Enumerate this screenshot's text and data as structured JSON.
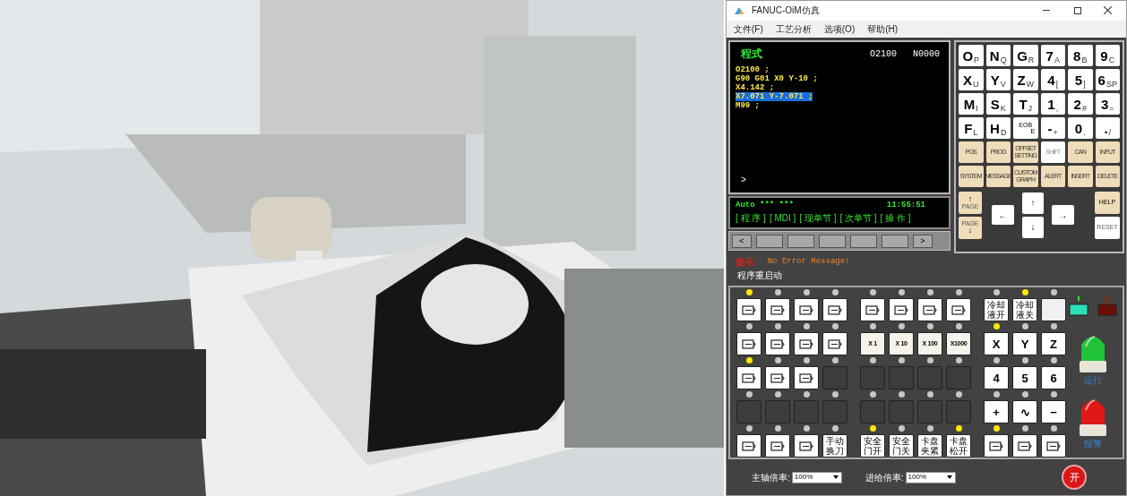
{
  "window": {
    "title": "FANUC-OiM仿真"
  },
  "menu": [
    "文件(F)",
    "工艺分析",
    "选项(O)",
    "帮助(H)"
  ],
  "cnc_screen": {
    "mode": "程式",
    "program": "O2100",
    "sequence": "N0000",
    "lines": [
      {
        "text": "O2100 ;",
        "selected": false
      },
      {
        "text": "G90 G01 X0 Y-10 ;",
        "selected": false
      },
      {
        "text": "X4.142 ;",
        "selected": false
      },
      {
        "text": "X7.071 Y-7.071 ;",
        "selected": true
      },
      {
        "text": "M99 ;",
        "selected": false
      }
    ],
    "prompt": ">",
    "status": "Auto *** ***",
    "time": "11:55:51",
    "softkeys": [
      "[ 程 序 ]",
      "[ MDI ]",
      "[ 现单节 ]",
      "[ 次单节 ]",
      "[ 操 作 ]"
    ],
    "scroll_left": "<",
    "scroll_right": ">"
  },
  "keypad_rows": [
    {
      "keys": [
        {
          "main": "O",
          "sub": "P",
          "kind": "address"
        },
        {
          "main": "N",
          "sub": "Q",
          "kind": "address"
        },
        {
          "main": "G",
          "sub": "R",
          "kind": "address"
        },
        {
          "main": "7",
          "sub": "A",
          "kind": "address"
        },
        {
          "main": "8",
          "sub": "B",
          "kind": "address"
        },
        {
          "main": "9",
          "sub": "C",
          "kind": "address"
        }
      ]
    },
    {
      "keys": [
        {
          "main": "X",
          "sub": "U",
          "kind": "address"
        },
        {
          "main": "Y",
          "sub": "V",
          "kind": "address"
        },
        {
          "main": "Z",
          "sub": "W",
          "kind": "address"
        },
        {
          "main": "4",
          "sub": "[",
          "kind": "address"
        },
        {
          "main": "5",
          "sub": "]",
          "kind": "address"
        },
        {
          "main": "6",
          "sub": "SP",
          "kind": "address"
        }
      ]
    },
    {
      "keys": [
        {
          "main": "M",
          "sub": "I",
          "kind": "address"
        },
        {
          "main": "S",
          "sub": "K",
          "kind": "address"
        },
        {
          "main": "T",
          "sub": "J",
          "kind": "address"
        },
        {
          "main": "1",
          "sub": ",",
          "kind": "address"
        },
        {
          "main": "2",
          "sub": "#",
          "kind": "address"
        },
        {
          "main": "3",
          "sub": "=",
          "kind": "address"
        }
      ]
    },
    {
      "keys": [
        {
          "main": "F",
          "sub": "L",
          "kind": "address"
        },
        {
          "main": "H",
          "sub": "D",
          "kind": "address"
        },
        {
          "main": "EOB",
          "sub": "E",
          "kind": "small"
        },
        {
          "main": "-",
          "sub": "+",
          "kind": "address"
        },
        {
          "main": "0",
          "sub": ".",
          "kind": "address"
        },
        {
          "main": ".",
          "sub": "/",
          "kind": "address"
        }
      ]
    },
    {
      "keys": [
        {
          "main": "POS",
          "kind": "function"
        },
        {
          "main": "PROG",
          "kind": "function"
        },
        {
          "main": "OFFSET SETTING",
          "kind": "function"
        },
        {
          "main": "SHIFT",
          "kind": "shift"
        },
        {
          "main": "CAN",
          "kind": "function"
        },
        {
          "main": "INPUT",
          "kind": "function"
        }
      ]
    },
    {
      "keys": [
        {
          "main": "SYSTEM",
          "kind": "function"
        },
        {
          "main": "MESSAGE",
          "kind": "function"
        },
        {
          "main": "CUSTOM GRAPH",
          "kind": "function"
        },
        {
          "main": "ALERT",
          "kind": "function"
        },
        {
          "main": "INSERT",
          "kind": "function"
        },
        {
          "main": "DELETE",
          "kind": "function"
        }
      ]
    }
  ],
  "nav_keys": {
    "page_up": {
      "arrow": "↑",
      "label": "PAGE"
    },
    "page_down": {
      "arrow": "↓",
      "label": "PAGE"
    },
    "left": "←",
    "up": "↑",
    "down": "↓",
    "right": "→",
    "help": "HELP",
    "reset": "RESET"
  },
  "message": {
    "label": "提示:",
    "text": "No Error Message!"
  },
  "status_text": "程序重启动",
  "panel_rows": [
    {
      "buttons": [
        {
          "kind": "icon",
          "lamp": true
        },
        {
          "kind": "icon",
          "lamp": false
        },
        {
          "kind": "icon",
          "lamp": false
        },
        {
          "kind": "icon",
          "lamp": false
        },
        {
          "kind": "icon",
          "lamp": false
        },
        {
          "kind": "icon",
          "lamp": false
        },
        {
          "kind": "icon",
          "lamp": false
        },
        {
          "kind": "icon",
          "lamp": false
        },
        {
          "kind": "text",
          "label": "冷却液开",
          "lamp": false
        },
        {
          "kind": "text",
          "label": "冷却液关",
          "lamp": true
        },
        {
          "kind": "plain",
          "lamp": false
        }
      ]
    },
    {
      "buttons": [
        {
          "kind": "icon",
          "lamp": false
        },
        {
          "kind": "icon",
          "lamp": false
        },
        {
          "kind": "icon",
          "lamp": false
        },
        {
          "kind": "icon",
          "lamp": false
        },
        {
          "kind": "small",
          "label": "X 1",
          "lamp": false
        },
        {
          "kind": "small",
          "label": "X 10",
          "lamp": false
        },
        {
          "kind": "small",
          "label": "X 100",
          "lamp": false
        },
        {
          "kind": "small",
          "label": "X1000",
          "lamp": false
        },
        {
          "kind": "key",
          "label": "X",
          "lamp": true
        },
        {
          "kind": "key",
          "label": "Y",
          "lamp": false
        },
        {
          "kind": "key",
          "label": "Z",
          "lamp": false
        }
      ]
    },
    {
      "buttons": [
        {
          "kind": "icon",
          "lamp": true
        },
        {
          "kind": "icon",
          "lamp": false
        },
        {
          "kind": "icon",
          "lamp": false
        },
        {
          "kind": "blank",
          "lamp": false
        },
        {
          "kind": "blank",
          "lamp": false
        },
        {
          "kind": "blank",
          "lamp": false
        },
        {
          "kind": "blank",
          "lamp": false
        },
        {
          "kind": "blank",
          "lamp": false
        },
        {
          "kind": "key",
          "label": "4",
          "lamp": false
        },
        {
          "kind": "key",
          "label": "5",
          "lamp": false
        },
        {
          "kind": "key",
          "label": "6",
          "lamp": false
        }
      ]
    },
    {
      "buttons": [
        {
          "kind": "blank",
          "lamp": false
        },
        {
          "kind": "blank",
          "lamp": false
        },
        {
          "kind": "blank",
          "lamp": false
        },
        {
          "kind": "blank",
          "lamp": false
        },
        {
          "kind": "blank",
          "lamp": false
        },
        {
          "kind": "blank",
          "lamp": false
        },
        {
          "kind": "blank",
          "lamp": false
        },
        {
          "kind": "blank",
          "lamp": false
        },
        {
          "kind": "key",
          "label": "+",
          "lamp": false
        },
        {
          "kind": "key",
          "label": "∿",
          "lamp": false
        },
        {
          "kind": "key",
          "label": "−",
          "lamp": false
        }
      ]
    },
    {
      "buttons": [
        {
          "kind": "icon",
          "lamp": false
        },
        {
          "kind": "icon",
          "lamp": false
        },
        {
          "kind": "icon",
          "lamp": false
        },
        {
          "kind": "text",
          "label": "手动换刀",
          "lamp": false
        },
        {
          "kind": "text",
          "label": "安全门开",
          "lamp": true
        },
        {
          "kind": "text",
          "label": "安全门关",
          "lamp": false
        },
        {
          "kind": "text",
          "label": "卡盘夹紧",
          "lamp": false
        },
        {
          "kind": "text",
          "label": "卡盘松开",
          "lamp": true
        },
        {
          "kind": "icon",
          "lamp": true
        },
        {
          "kind": "icon",
          "lamp": false
        },
        {
          "kind": "icon",
          "lamp": false
        }
      ]
    }
  ],
  "beacons": [
    {
      "label": "运行",
      "color": "#22c33a"
    },
    {
      "label": "报警",
      "color": "#e01818"
    }
  ],
  "overrides": [
    {
      "label": "主轴倍率:",
      "value": "100%"
    },
    {
      "label": "进给倍率:",
      "value": "100%"
    }
  ],
  "power_button": "开"
}
